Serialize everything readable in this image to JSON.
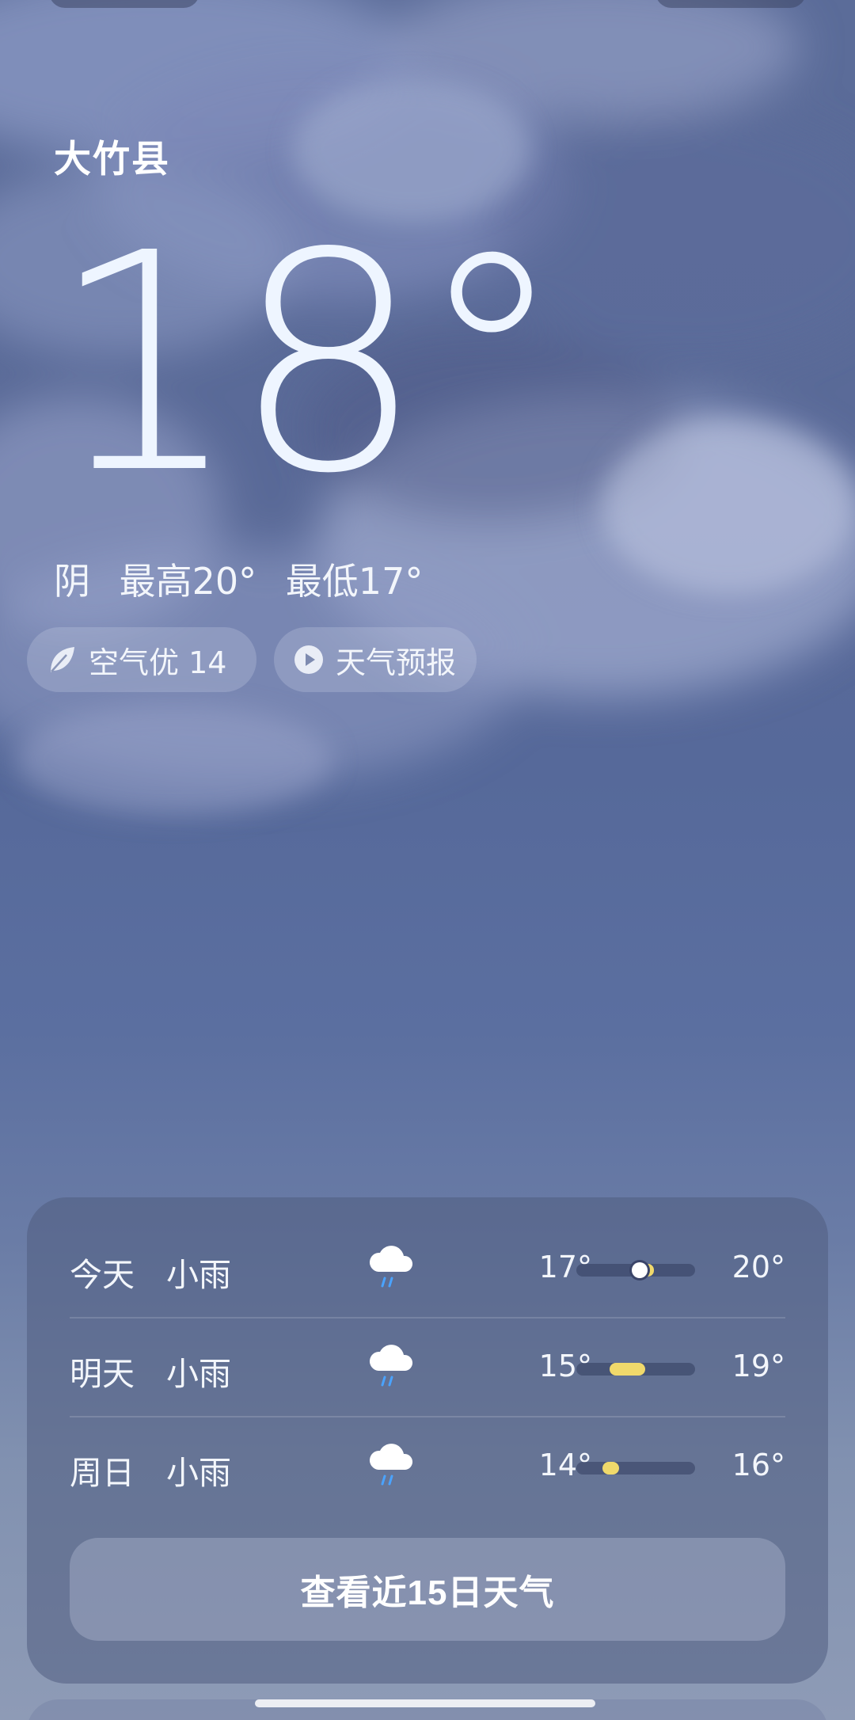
{
  "location": {
    "city": "大竹县"
  },
  "current": {
    "temperature": "18",
    "degree_symbol": "°",
    "condition": "阴",
    "high_label": "最高20°",
    "low_label": "最低17°"
  },
  "chips": {
    "air": {
      "label": "空气优 14",
      "icon": "leaf-icon"
    },
    "forecast_video": {
      "label": "天气预报",
      "icon": "play-icon"
    }
  },
  "daily": [
    {
      "day": "今天",
      "condition": "小雨",
      "icon": "cloud-rain-icon",
      "low": "17°",
      "high": "20°",
      "fill_start": 0.55,
      "fill_end": 0.65,
      "current_marker": true
    },
    {
      "day": "明天",
      "condition": "小雨",
      "icon": "cloud-rain-icon",
      "low": "15°",
      "high": "19°",
      "fill_start": 0.28,
      "fill_end": 0.58,
      "current_marker": false
    },
    {
      "day": "周日",
      "condition": "小雨",
      "icon": "cloud-rain-icon",
      "low": "14°",
      "high": "16°",
      "fill_start": 0.22,
      "fill_end": 0.36,
      "current_marker": false
    }
  ],
  "more_button": {
    "label": "查看近15日天气"
  },
  "colors": {
    "range_fill": "#f0d96b",
    "rain_drop": "#4aa3ff"
  }
}
